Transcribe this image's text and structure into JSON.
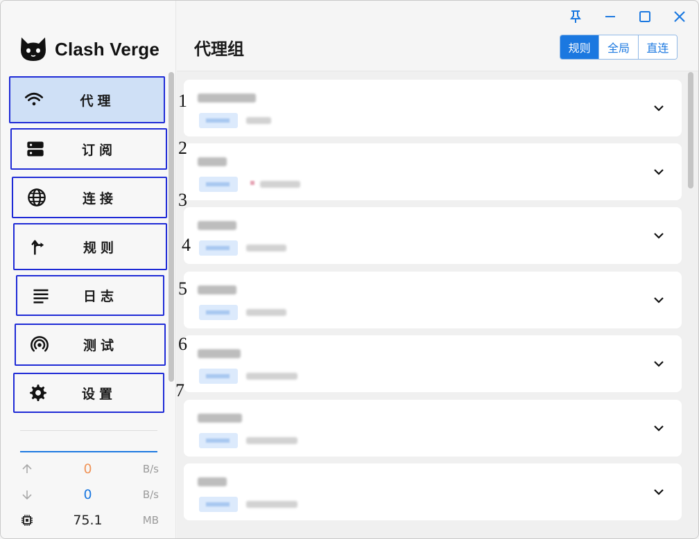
{
  "app": {
    "name": "Clash Verge"
  },
  "header": {
    "title": "代理组",
    "modes": [
      {
        "label": "规则",
        "active": true
      },
      {
        "label": "全局",
        "active": false
      },
      {
        "label": "直连",
        "active": false
      }
    ]
  },
  "window_controls": [
    "pin-icon",
    "minimize-icon",
    "maximize-icon",
    "close-icon"
  ],
  "sidebar": {
    "items": [
      {
        "label": "代理",
        "icon": "wifi-icon",
        "number": "1",
        "active": true
      },
      {
        "label": "订阅",
        "icon": "server-icon",
        "number": "2",
        "active": false
      },
      {
        "label": "连接",
        "icon": "globe-icon",
        "number": "3",
        "active": false
      },
      {
        "label": "规则",
        "icon": "route-icon",
        "number": "4",
        "active": false
      },
      {
        "label": "日志",
        "icon": "notes-icon",
        "number": "5",
        "active": false
      },
      {
        "label": "测试",
        "icon": "radar-icon",
        "number": "6",
        "active": false
      },
      {
        "label": "设置",
        "icon": "gear-icon",
        "number": "7",
        "active": false
      }
    ],
    "traffic": {
      "upload": {
        "value": "0",
        "unit": "B/s",
        "color": "#f0955a"
      },
      "download": {
        "value": "0",
        "unit": "B/s",
        "color": "#1b78e0"
      },
      "memory": {
        "value": "75.1",
        "unit": "MB"
      }
    }
  },
  "proxy_groups_count": 7,
  "colors": {
    "accent": "#1b78e0",
    "annotation_border": "#1e2ad6",
    "active_bg": "#cfe0f6"
  }
}
